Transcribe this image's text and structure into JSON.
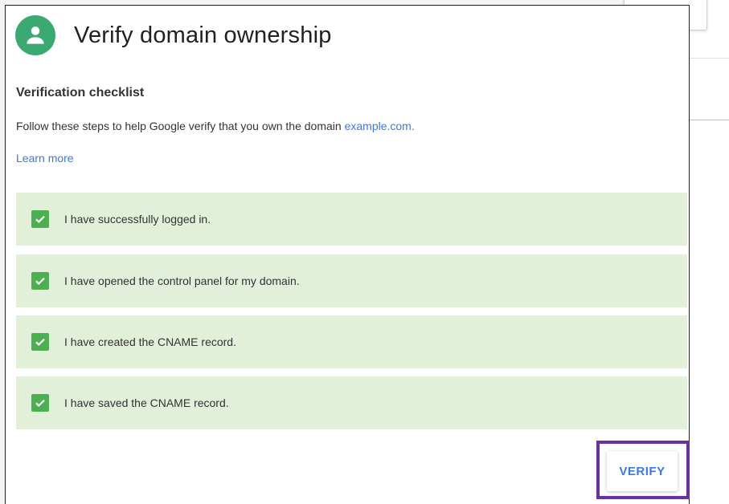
{
  "dialog": {
    "title": "Verify domain ownership",
    "avatar_icon": "person-icon",
    "avatar_color": "#3aaa72"
  },
  "checklist": {
    "heading": "Verification checklist",
    "instructions_prefix": "Follow these steps to help Google verify that you own the domain ",
    "domain": "example.com.",
    "learn_more": "Learn more",
    "items": [
      {
        "label": "I have successfully logged in.",
        "checked": true
      },
      {
        "label": "I have opened the control panel for my domain.",
        "checked": true
      },
      {
        "label": "I have created the CNAME record.",
        "checked": true
      },
      {
        "label": "I have saved the CNAME record.",
        "checked": true
      }
    ],
    "item_background": "#e2efd9",
    "checkbox_color": "#4caf50"
  },
  "actions": {
    "verify_label": "VERIFY",
    "accent_color": "#3b78e7",
    "highlight_color": "#6b2fa0"
  }
}
